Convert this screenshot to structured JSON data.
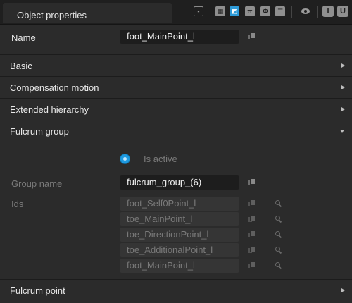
{
  "window": {
    "title": "Object properties"
  },
  "toolbar": {
    "icons": [
      "frame-icon",
      "grid-icon",
      "layers-icon",
      "pi-icon",
      "split-icon",
      "list-icon",
      "eye-icon",
      "text-cursor-icon",
      "underline-icon"
    ],
    "pi_glyph": "π",
    "split_glyph": "Φ",
    "list_glyph": "☰",
    "ibeam_glyph": "I",
    "underline_glyph": "U"
  },
  "name": {
    "label": "Name",
    "value": "foot_MainPoint_l"
  },
  "sections": {
    "basic": "Basic",
    "compensation_motion": "Compensation motion",
    "extended_hierarchy": "Extended hierarchy",
    "fulcrum_group": "Fulcrum group",
    "fulcrum_point": "Fulcrum point"
  },
  "fulcrum_group": {
    "is_active_label": "Is active",
    "is_active": true,
    "group_name_label": "Group name",
    "group_name_value": "fulcrum_group_(6)",
    "ids_label": "Ids",
    "ids": [
      "foot_Self0Point_l",
      "toe_MainPoint_l",
      "toe_DirectionPoint_l",
      "toe_AdditionalPoint_l",
      "foot_MainPoint_l"
    ]
  },
  "colors": {
    "accent": "#1e9ae0",
    "background": "#2b2b2b",
    "titlebar": "#1f1f1f"
  }
}
